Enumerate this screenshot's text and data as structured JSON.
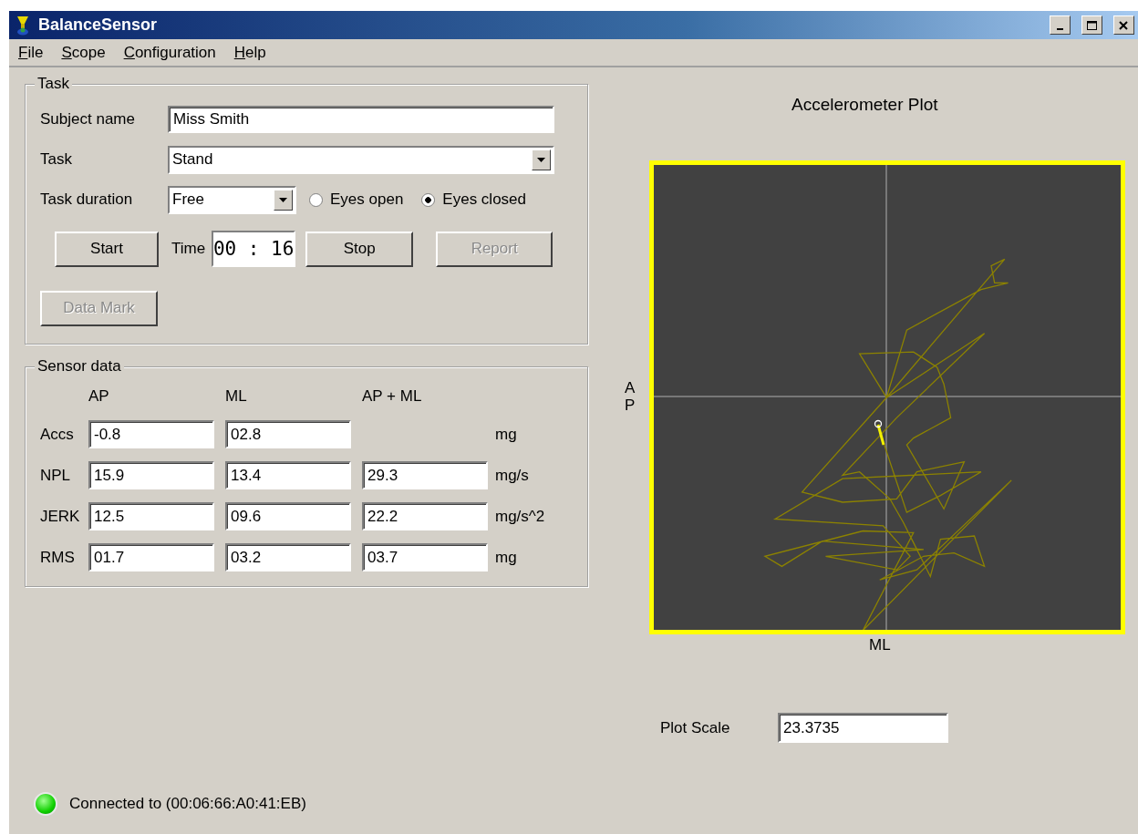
{
  "window": {
    "title": "BalanceSensor"
  },
  "menu": [
    "File",
    "Scope",
    "Configuration",
    "Help"
  ],
  "task_group": {
    "title": "Task",
    "subject_name": {
      "label": "Subject name",
      "value": "Miss Smith"
    },
    "task": {
      "label": "Task",
      "value": "Stand"
    },
    "task_duration": {
      "label": "Task duration",
      "value": "Free"
    },
    "eyes": [
      {
        "label": "Eyes open",
        "selected": false
      },
      {
        "label": "Eyes closed",
        "selected": true
      }
    ],
    "time": {
      "label": "Time",
      "value": "00 : 16"
    },
    "buttons": [
      {
        "label": "Start",
        "disabled": false
      },
      {
        "label": "Stop",
        "disabled": false
      },
      {
        "label": "Report",
        "disabled": true
      }
    ],
    "data_mark": {
      "label": "Data Mark",
      "disabled": true
    }
  },
  "sensor_group": {
    "title": "Sensor data",
    "columns": [
      "AP",
      "ML",
      "AP + ML"
    ],
    "rows": [
      {
        "label": "Accs",
        "values": [
          "-0.8",
          "02.8"
        ],
        "unit": "mg"
      },
      {
        "label": "NPL",
        "values": [
          "15.9",
          "13.4",
          "29.3"
        ],
        "unit": "mg/s"
      },
      {
        "label": "JERK",
        "values": [
          "12.5",
          "09.6",
          "22.2"
        ],
        "unit": "mg/s^2"
      },
      {
        "label": "RMS",
        "values": [
          "01.7",
          "03.2",
          "03.7"
        ],
        "unit": "mg"
      }
    ]
  },
  "plot": {
    "title": "Accelerometer Plot",
    "y_label": "AP",
    "x_label": "ML"
  },
  "plot_scale": {
    "label": "Plot Scale",
    "value": "23.3735"
  },
  "status": {
    "connected": true,
    "text": "Connected to (00:06:66:A0:41:EB)"
  }
}
